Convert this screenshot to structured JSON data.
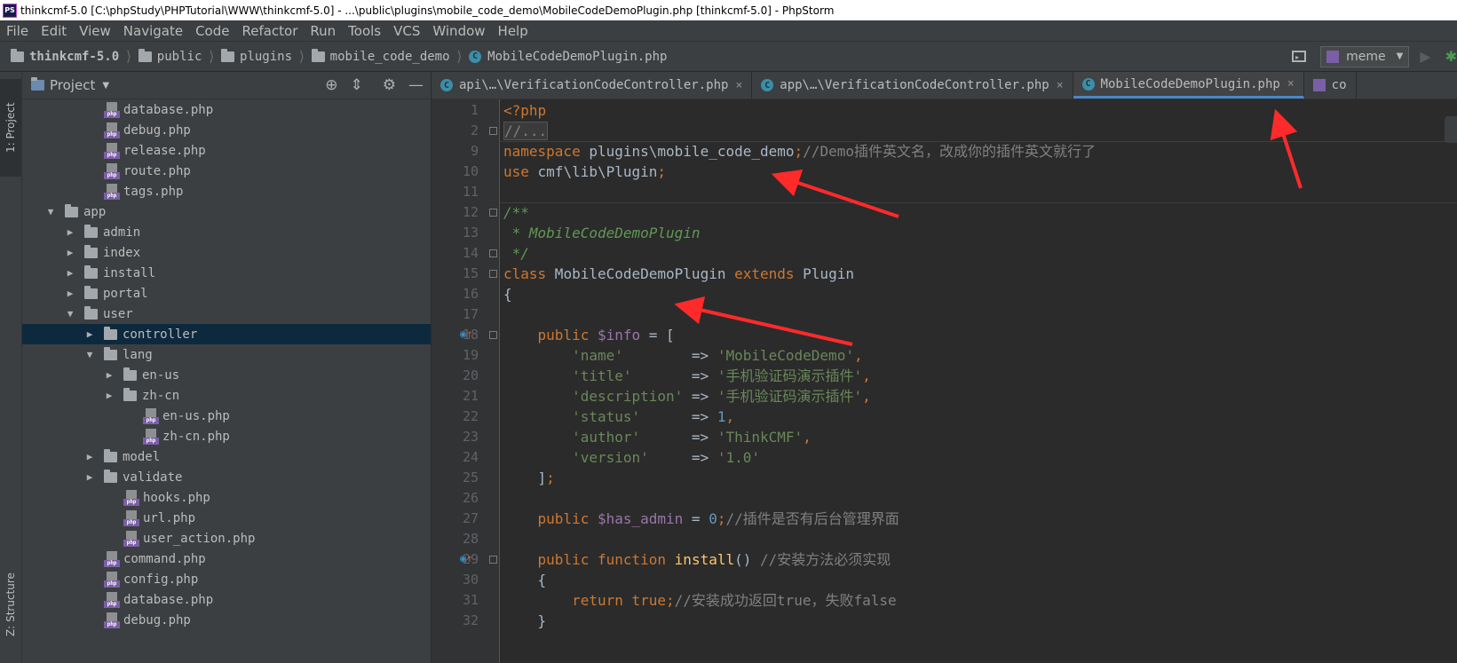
{
  "window": {
    "title": "thinkcmf-5.0 [C:\\phpStudy\\PHPTutorial\\WWW\\thinkcmf-5.0] - ...\\public\\plugins\\mobile_code_demo\\MobileCodeDemoPlugin.php [thinkcmf-5.0] - PhpStorm",
    "logo_text": "PS"
  },
  "menu": [
    "File",
    "Edit",
    "View",
    "Navigate",
    "Code",
    "Refactor",
    "Run",
    "Tools",
    "VCS",
    "Window",
    "Help"
  ],
  "breadcrumb": {
    "root": "thinkcmf-5.0",
    "items": [
      "public",
      "plugins",
      "mobile_code_demo"
    ],
    "file": "MobileCodeDemoPlugin.php"
  },
  "run_config": {
    "label": "meme"
  },
  "left_tabs": {
    "project": "1: Project",
    "structure": "Z: Structure"
  },
  "project_panel": {
    "title": "Project",
    "tree": [
      {
        "type": "file",
        "name": "database.php",
        "depth": 3
      },
      {
        "type": "file",
        "name": "debug.php",
        "depth": 3
      },
      {
        "type": "file",
        "name": "release.php",
        "depth": 3
      },
      {
        "type": "file",
        "name": "route.php",
        "depth": 3
      },
      {
        "type": "file",
        "name": "tags.php",
        "depth": 3
      },
      {
        "type": "folder",
        "name": "app",
        "depth": 1,
        "expanded": true
      },
      {
        "type": "folder",
        "name": "admin",
        "depth": 2,
        "expanded": false
      },
      {
        "type": "folder",
        "name": "index",
        "depth": 2,
        "expanded": false
      },
      {
        "type": "folder",
        "name": "install",
        "depth": 2,
        "expanded": false
      },
      {
        "type": "folder",
        "name": "portal",
        "depth": 2,
        "expanded": false
      },
      {
        "type": "folder",
        "name": "user",
        "depth": 2,
        "expanded": true
      },
      {
        "type": "folder",
        "name": "controller",
        "depth": 3,
        "expanded": false,
        "selected": true
      },
      {
        "type": "folder",
        "name": "lang",
        "depth": 3,
        "expanded": true
      },
      {
        "type": "folder",
        "name": "en-us",
        "depth": 4,
        "expanded": false
      },
      {
        "type": "folder",
        "name": "zh-cn",
        "depth": 4,
        "expanded": false
      },
      {
        "type": "file",
        "name": "en-us.php",
        "depth": 5
      },
      {
        "type": "file",
        "name": "zh-cn.php",
        "depth": 5
      },
      {
        "type": "folder",
        "name": "model",
        "depth": 3,
        "expanded": false
      },
      {
        "type": "folder",
        "name": "validate",
        "depth": 3,
        "expanded": false
      },
      {
        "type": "file",
        "name": "hooks.php",
        "depth": 4
      },
      {
        "type": "file",
        "name": "url.php",
        "depth": 4
      },
      {
        "type": "file",
        "name": "user_action.php",
        "depth": 4
      },
      {
        "type": "file",
        "name": "command.php",
        "depth": 3
      },
      {
        "type": "file",
        "name": "config.php",
        "depth": 3
      },
      {
        "type": "file",
        "name": "database.php",
        "depth": 3
      },
      {
        "type": "file",
        "name": "debug.php",
        "depth": 3
      }
    ]
  },
  "tabs": [
    {
      "label": "api\\…\\VerificationCodeController.php",
      "active": false
    },
    {
      "label": "app\\…\\VerificationCodeController.php",
      "active": false
    },
    {
      "label": "MobileCodeDemoPlugin.php",
      "active": true
    },
    {
      "label": "co",
      "active": false
    }
  ],
  "colors": {
    "accent": "#4a88c7",
    "keyword": "#cc7832",
    "string": "#6a8759",
    "comment": "#808080",
    "annotation_arrow": "#ff2a2a"
  },
  "code": {
    "line_numbers": [
      "1",
      "2",
      "9",
      "10",
      "11",
      "12",
      "13",
      "14",
      "15",
      "16",
      "17",
      "18",
      "19",
      "20",
      "21",
      "22",
      "23",
      "24",
      "25",
      "26",
      "27",
      "28",
      "29",
      "30",
      "31",
      "32"
    ],
    "lines": [
      [
        {
          "t": "kw",
          "v": "<?php"
        }
      ],
      [
        {
          "t": "cm",
          "v": "//..."
        }
      ],
      [
        {
          "t": "kw",
          "v": "namespace"
        },
        {
          "t": "pl",
          "v": " plugins\\mobile_code_demo"
        },
        {
          "t": "kw",
          "v": ";"
        },
        {
          "t": "cm",
          "v": "//Demo插件英文名，改成你的插件英文就行了"
        }
      ],
      [
        {
          "t": "kw",
          "v": "use"
        },
        {
          "t": "pl",
          "v": " cmf\\lib\\Plugin"
        },
        {
          "t": "kw",
          "v": ";"
        }
      ],
      [],
      [
        {
          "t": "doc",
          "v": "/**"
        }
      ],
      [
        {
          "t": "doc",
          "v": " * MobileCodeDemoPlugin"
        }
      ],
      [
        {
          "t": "doc",
          "v": " */"
        }
      ],
      [
        {
          "t": "kw",
          "v": "class"
        },
        {
          "t": "pl",
          "v": " MobileCodeDemoPlugin "
        },
        {
          "t": "kw",
          "v": "extends"
        },
        {
          "t": "pl",
          "v": " Plugin"
        }
      ],
      [
        {
          "t": "pl",
          "v": "{"
        }
      ],
      [],
      [
        {
          "t": "pl",
          "v": "    "
        },
        {
          "t": "kw",
          "v": "public"
        },
        {
          "t": "pl",
          "v": " "
        },
        {
          "t": "var",
          "v": "$info"
        },
        {
          "t": "pl",
          "v": " = ["
        }
      ],
      [
        {
          "t": "pl",
          "v": "        "
        },
        {
          "t": "str",
          "v": "'name'"
        },
        {
          "t": "pl",
          "v": "        => "
        },
        {
          "t": "str",
          "v": "'MobileCodeDemo'"
        },
        {
          "t": "kw",
          "v": ","
        }
      ],
      [
        {
          "t": "pl",
          "v": "        "
        },
        {
          "t": "str",
          "v": "'title'"
        },
        {
          "t": "pl",
          "v": "       => "
        },
        {
          "t": "str",
          "v": "'手机验证码演示插件'"
        },
        {
          "t": "kw",
          "v": ","
        }
      ],
      [
        {
          "t": "pl",
          "v": "        "
        },
        {
          "t": "str",
          "v": "'description'"
        },
        {
          "t": "pl",
          "v": " => "
        },
        {
          "t": "str",
          "v": "'手机验证码演示插件'"
        },
        {
          "t": "kw",
          "v": ","
        }
      ],
      [
        {
          "t": "pl",
          "v": "        "
        },
        {
          "t": "str",
          "v": "'status'"
        },
        {
          "t": "pl",
          "v": "      => "
        },
        {
          "t": "num",
          "v": "1"
        },
        {
          "t": "kw",
          "v": ","
        }
      ],
      [
        {
          "t": "pl",
          "v": "        "
        },
        {
          "t": "str",
          "v": "'author'"
        },
        {
          "t": "pl",
          "v": "      => "
        },
        {
          "t": "str",
          "v": "'ThinkCMF'"
        },
        {
          "t": "kw",
          "v": ","
        }
      ],
      [
        {
          "t": "pl",
          "v": "        "
        },
        {
          "t": "str",
          "v": "'version'"
        },
        {
          "t": "pl",
          "v": "     => "
        },
        {
          "t": "str",
          "v": "'1.0'"
        }
      ],
      [
        {
          "t": "pl",
          "v": "    ]"
        },
        {
          "t": "kw",
          "v": ";"
        }
      ],
      [],
      [
        {
          "t": "pl",
          "v": "    "
        },
        {
          "t": "kw",
          "v": "public"
        },
        {
          "t": "pl",
          "v": " "
        },
        {
          "t": "var",
          "v": "$has_admin"
        },
        {
          "t": "pl",
          "v": " = "
        },
        {
          "t": "num",
          "v": "0"
        },
        {
          "t": "kw",
          "v": ";"
        },
        {
          "t": "cm",
          "v": "//插件是否有后台管理界面"
        }
      ],
      [],
      [
        {
          "t": "pl",
          "v": "    "
        },
        {
          "t": "kw",
          "v": "public function"
        },
        {
          "t": "pl",
          "v": " "
        },
        {
          "t": "fn",
          "v": "install"
        },
        {
          "t": "pl",
          "v": "() "
        },
        {
          "t": "cm",
          "v": "//安装方法必须实现"
        }
      ],
      [
        {
          "t": "pl",
          "v": "    {"
        }
      ],
      [
        {
          "t": "pl",
          "v": "        "
        },
        {
          "t": "kw",
          "v": "return true;"
        },
        {
          "t": "cm",
          "v": "//安装成功返回true，失败false"
        }
      ],
      [
        {
          "t": "pl",
          "v": "    }"
        }
      ]
    ]
  }
}
